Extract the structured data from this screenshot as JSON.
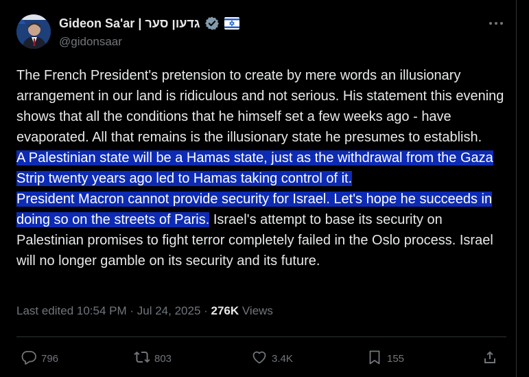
{
  "tweet": {
    "display_name": "Gideon Sa'ar | גדעון סער",
    "handle": "@gidonsaar",
    "verified_icon": "verified-badge-icon",
    "flag_icon": "israel-flag-icon",
    "text_plain_1": "The French President's pretension to create by mere words an illusionary arrangement in our land is ridiculous and not serious. His statement this evening shows that all the conditions that he himself set a few weeks ago - have evaporated. All that remains is the illusionary state he presumes to establish.",
    "text_hl_1": "A Palestinian state will be a Hamas state, just as the withdrawal from the Gaza Strip twenty years ago led to Hamas taking control of it. ",
    "text_hl_2": "President Macron cannot provide security for Israel. Let's hope he succeeds in doing so on the streets of Paris.",
    "text_plain_2": " Israel's attempt to base its security on Palestinian promises to fight terror completely failed in the Oslo process. Israel will no longer gamble on its security and its future.",
    "timestamp": "Last edited 10:54 PM · Jul 24, 2025 · ",
    "views_count": "276K",
    "views_label": " Views"
  },
  "actions": {
    "replies": "796",
    "reposts": "803",
    "likes": "3.4K",
    "bookmarks": "155"
  },
  "colors": {
    "background": "#000000",
    "text": "#e7e9ea",
    "muted": "#71767b",
    "highlight": "#0d2bb5",
    "verified": "#829aab"
  }
}
